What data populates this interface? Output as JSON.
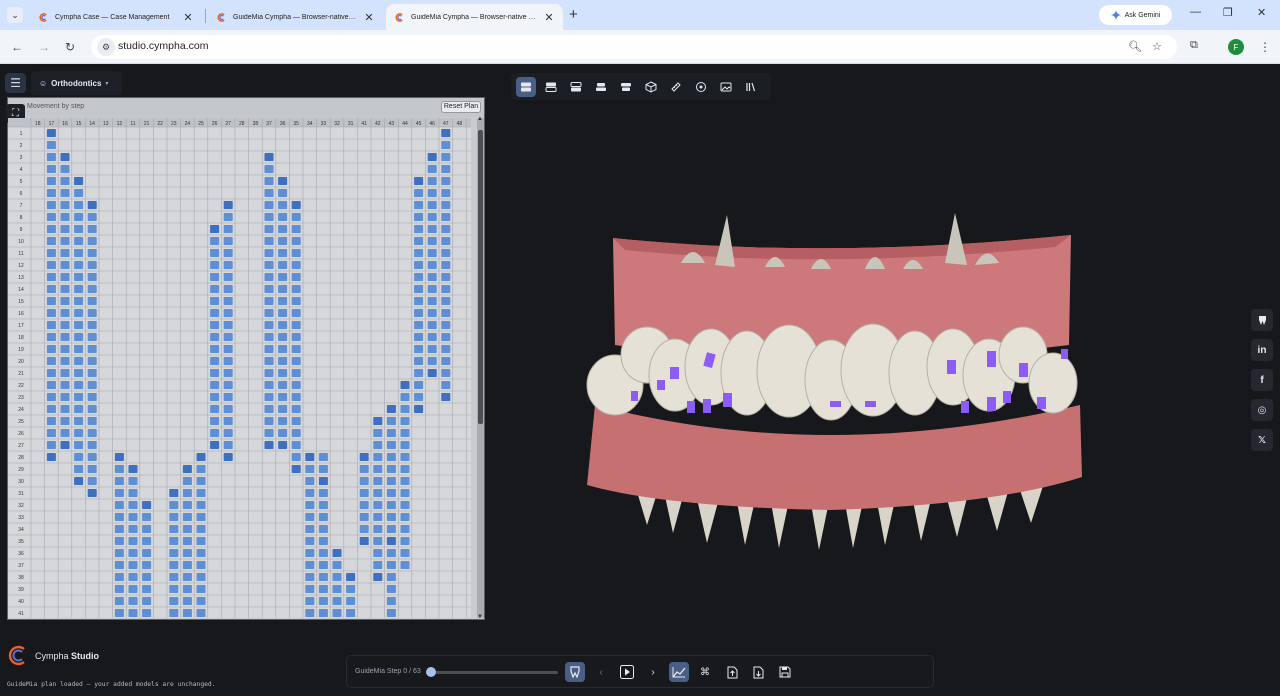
{
  "browser": {
    "tabs": [
      {
        "title": "Cympha Case — Case Management"
      },
      {
        "title": "GuideMia Cympha — Browser-native digital dental"
      },
      {
        "title": "GuideMia Cympha — Browser-native digital dental"
      }
    ],
    "gemini_label": "Ask Gemini",
    "url": "studio.cympha.com",
    "profile_initial": "F"
  },
  "app": {
    "mode_label": "Orthodontics",
    "panel_title": "Movement by step",
    "reset_label": "Reset Plan",
    "toolbar_icons": [
      "view-upper-lower-icon",
      "view-upper-icon",
      "view-lower-icon",
      "view-occlusal-icon",
      "view-split-icon",
      "box-icon",
      "ruler-icon",
      "rotate-icon",
      "image-icon",
      "library-icon"
    ],
    "social_icons": [
      "tooth-icon",
      "linkedin-icon",
      "facebook-icon",
      "instagram-icon",
      "x-icon"
    ],
    "logo": {
      "brand": "Cympha",
      "product": "Studio"
    },
    "status": "GuideMia plan loaded — your added models are unchanged.",
    "player": {
      "step_label": "GuideMia Step 0 / 63",
      "progress": 0,
      "buttons": [
        "tooth-icon",
        "prev-icon",
        "play-icon",
        "next-icon",
        "chart-icon",
        "attachment-icon",
        "export-icon",
        "import-icon",
        "save-icon"
      ]
    }
  },
  "colors": {
    "accent": "#4a5f86",
    "cell_on": "#5e8ed6",
    "cell_on_dark": "#3f6fc0",
    "gingiva": "#cf7a7c",
    "tooth": "#e5e1d6",
    "attachment": "#8b5cf6"
  },
  "movement_table": {
    "teeth": [
      "18",
      "17",
      "16",
      "15",
      "14",
      "13",
      "12",
      "11",
      "21",
      "22",
      "23",
      "24",
      "25",
      "26",
      "27",
      "28",
      "38",
      "37",
      "36",
      "35",
      "34",
      "33",
      "32",
      "31",
      "41",
      "42",
      "43",
      "44",
      "45",
      "46",
      "47",
      "48"
    ],
    "steps": [
      "1",
      "2",
      "3",
      "4",
      "5",
      "6",
      "7",
      "8",
      "9",
      "10",
      "11",
      "12",
      "13",
      "14",
      "15",
      "16",
      "17",
      "18",
      "19",
      "20",
      "21",
      "22",
      "23",
      "24",
      "25",
      "26",
      "27",
      "28",
      "29",
      "30",
      "31",
      "32",
      "33",
      "34",
      "35",
      "36",
      "37",
      "38",
      "39",
      "40",
      "41"
    ]
  }
}
